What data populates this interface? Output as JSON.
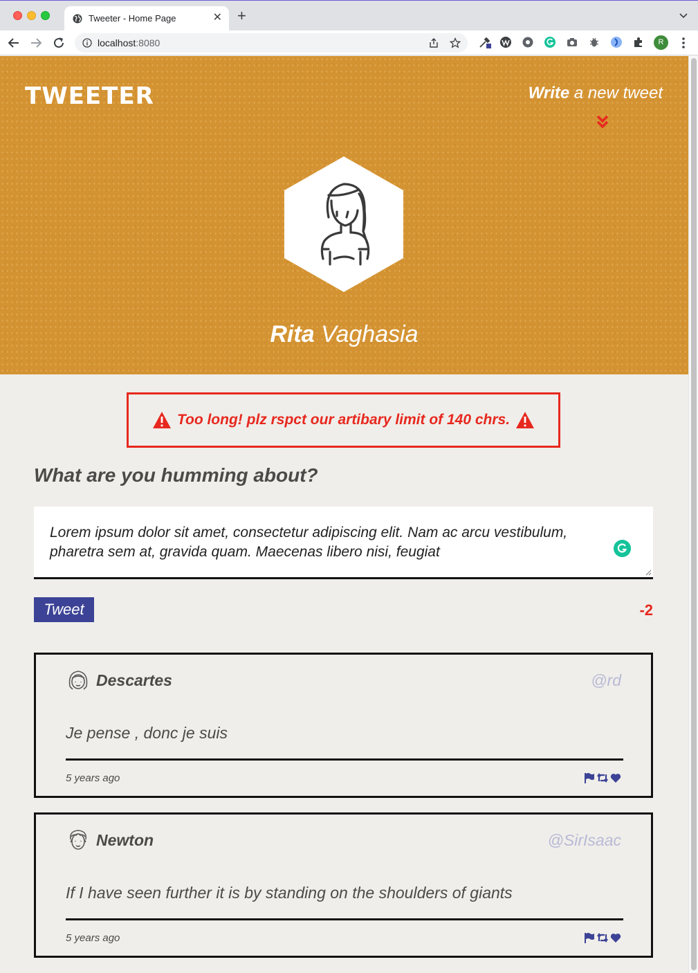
{
  "browser": {
    "tab_title": "Tweeter - Home Page",
    "tab_close": "✕",
    "new_tab": "+",
    "url_host": "localhost",
    "url_port": ":8080",
    "profile_initial": "R"
  },
  "header": {
    "logo": "TWEETER",
    "write_bold": "Write",
    "write_rest": " a new tweet"
  },
  "profile": {
    "first_name": "Rita",
    "last_name": " Vaghasia"
  },
  "error": {
    "message": "Too long! plz rspct our artibary limit of 140 chrs."
  },
  "compose": {
    "title": "What are you humming about?",
    "text": "Lorem ipsum dolor sit amet, consectetur adipiscing elit. Nam ac arcu vestibulum, pharetra sem at, gravida quam. Maecenas libero nisi, feugiat",
    "button_label": "Tweet",
    "counter": "-2"
  },
  "tweets": [
    {
      "name": "Descartes",
      "handle": "@rd",
      "text": "Je pense , donc je suis",
      "time": "5 years ago"
    },
    {
      "name": "Newton",
      "handle": "@SirIsaac",
      "text": "If I have seen further it is by standing on the shoulders of giants",
      "time": "5 years ago"
    }
  ],
  "colors": {
    "hero": "#d49332",
    "accent": "#3c4396",
    "error": "#e7281e",
    "handle": "#b8b9d6"
  }
}
